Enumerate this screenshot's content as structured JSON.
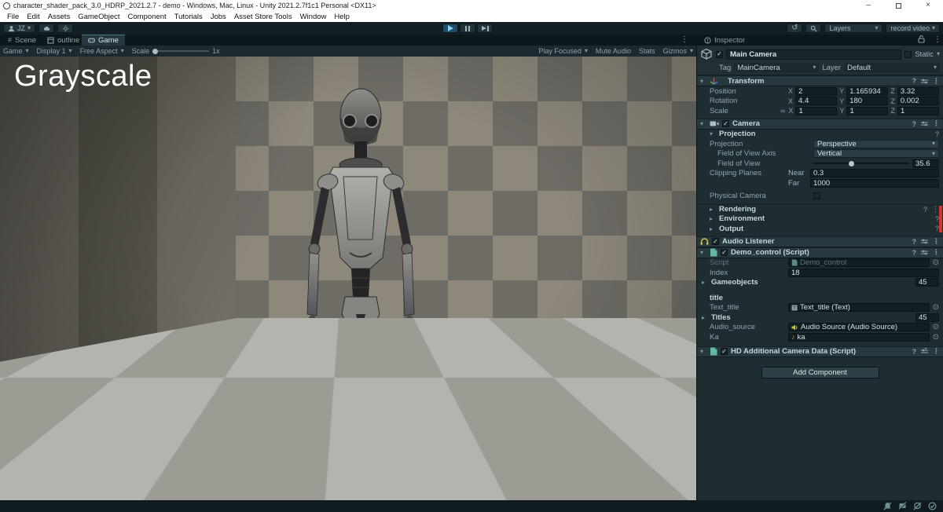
{
  "window": {
    "title": "character_shader_pack_3.0_HDRP_2021.2.7 - demo - Windows, Mac, Linux - Unity 2021.2.7f1c1 Personal <DX11>"
  },
  "menu": {
    "items": [
      "File",
      "Edit",
      "Assets",
      "GameObject",
      "Component",
      "Tutorials",
      "Jobs",
      "Asset Store Tools",
      "Window",
      "Help"
    ]
  },
  "toolbar": {
    "account_label": "JZ",
    "layers_label": "Layers",
    "record_label": "record video"
  },
  "tabs": {
    "scene": "Scene",
    "outline": "outline",
    "game": "Game",
    "inspector": "Inspector"
  },
  "gamebar": {
    "view": "Game",
    "display": "Display 1",
    "aspect": "Free Aspect",
    "scale_label": "Scale",
    "scale_value": "1x",
    "play_focused": "Play Focused",
    "mute_audio": "Mute Audio",
    "stats": "Stats",
    "gizmos": "Gizmos"
  },
  "game": {
    "overlay_title": "Grayscale"
  },
  "inspector": {
    "go": {
      "name": "Main Camera",
      "static_label": "Static",
      "tag_label": "Tag",
      "tag_value": "MainCamera",
      "layer_label": "Layer",
      "layer_value": "Default"
    },
    "axis": {
      "x": "X",
      "y": "Y",
      "z": "Z"
    },
    "transform": {
      "title": "Transform",
      "rows": [
        {
          "label": "Position",
          "x": "2",
          "y": "1.165934",
          "z": "3.32"
        },
        {
          "label": "Rotation",
          "x": "4.4",
          "y": "180",
          "z": "0.002"
        },
        {
          "label": "Scale",
          "x": "1",
          "y": "1",
          "z": "1"
        }
      ]
    },
    "camera": {
      "title": "Camera",
      "group": "Projection",
      "projection_label": "Projection",
      "projection_value": "Perspective",
      "fov_axis_label": "Field of View Axis",
      "fov_axis_value": "Vertical",
      "fov_label": "Field of View",
      "fov_value": "35.6",
      "clip_label": "Clipping Planes",
      "near_label": "Near",
      "near_value": "0.3",
      "far_label": "Far",
      "far_value": "1000",
      "physical_label": "Physical Camera",
      "rendering": "Rendering",
      "environment": "Environment",
      "output": "Output"
    },
    "audio_listener": {
      "title": "Audio Listener"
    },
    "demo": {
      "title": "Demo_control (Script)",
      "script_label": "Script",
      "script_value": "Demo_control",
      "index_label": "Index",
      "index_value": "18",
      "gameobjects_label": "Gameobjects",
      "gameobjects_count": "45",
      "section_title": "title",
      "text_title_label": "Text_title",
      "text_title_value": "Text_title (Text)",
      "titles_label": "Titles",
      "titles_count": "45",
      "audio_label": "Audio_source",
      "audio_value": "Audio Source (Audio Source)",
      "ka_label": "Ka",
      "ka_value": "ka"
    },
    "hd": {
      "title": "HD Additional Camera Data (Script)"
    },
    "add_component": "Add Component"
  },
  "icons": {
    "caret": "▾",
    "fold_open": "▾",
    "fold_closed": "▸",
    "more": "⋮",
    "help": "?",
    "check": "✓",
    "target": "⊙",
    "link": "∞",
    "note": "♪",
    "minimize": "–",
    "close": "×",
    "history": "↺",
    "hash": "#"
  },
  "colors": {
    "play_accent": "#7fd4f5",
    "record_marker_red": "#d9342b",
    "gizmo_orange": "#e0862f",
    "audio_icon_yellow": "#d8c93c",
    "script_icon_teal": "#63b8a2"
  }
}
